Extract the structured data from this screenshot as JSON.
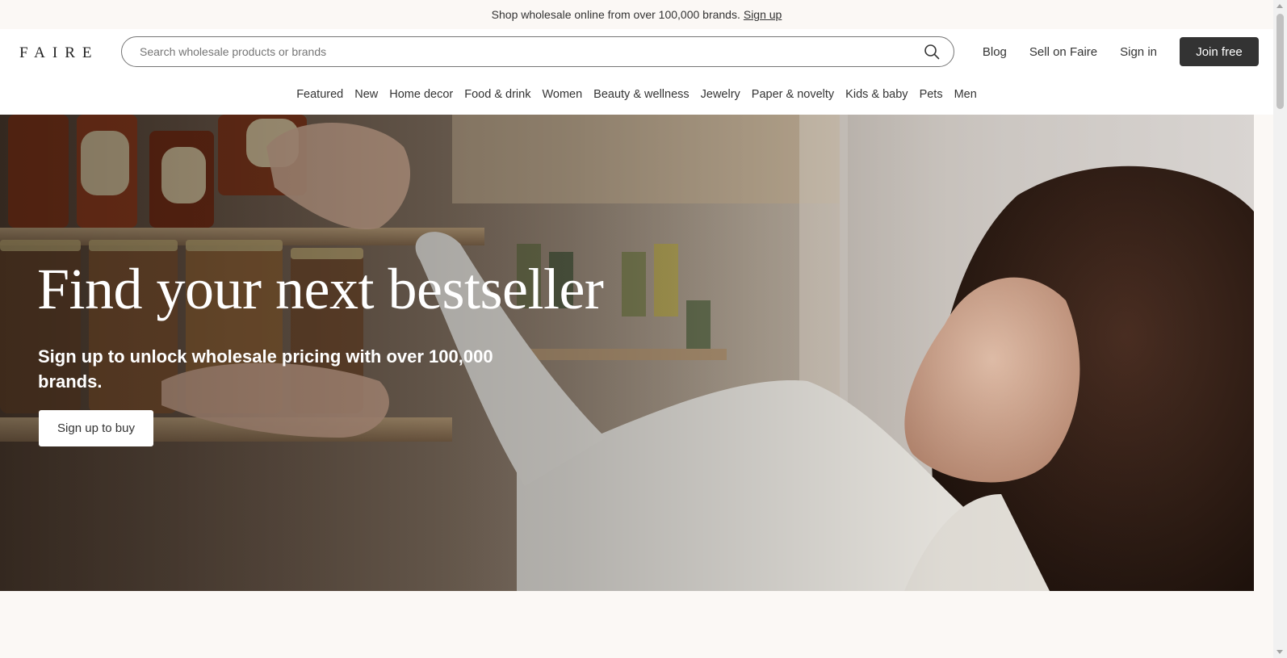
{
  "announcement": {
    "text": "Shop wholesale online from over 100,000 brands.",
    "link": "Sign up"
  },
  "header": {
    "logo": "FAIRE",
    "search_placeholder": "Search wholesale products or brands",
    "search_value": "",
    "nav_links": [
      "Blog",
      "Sell on Faire",
      "Sign in"
    ],
    "join_label": "Join free",
    "join_bg_color": "#333333"
  },
  "categories": [
    "Featured",
    "New",
    "Home decor",
    "Food & drink",
    "Women",
    "Beauty & wellness",
    "Jewelry",
    "Paper & novelty",
    "Kids & baby",
    "Pets",
    "Men"
  ],
  "hero": {
    "title": "Find your next bestseller",
    "subtitle": "Sign up to unlock wholesale pricing with over 100,000 brands.",
    "cta_label": "Sign up to buy"
  },
  "icons": {
    "search": "search-icon",
    "scroll_up": "chevron-up-icon",
    "scroll_down": "chevron-down-icon"
  }
}
